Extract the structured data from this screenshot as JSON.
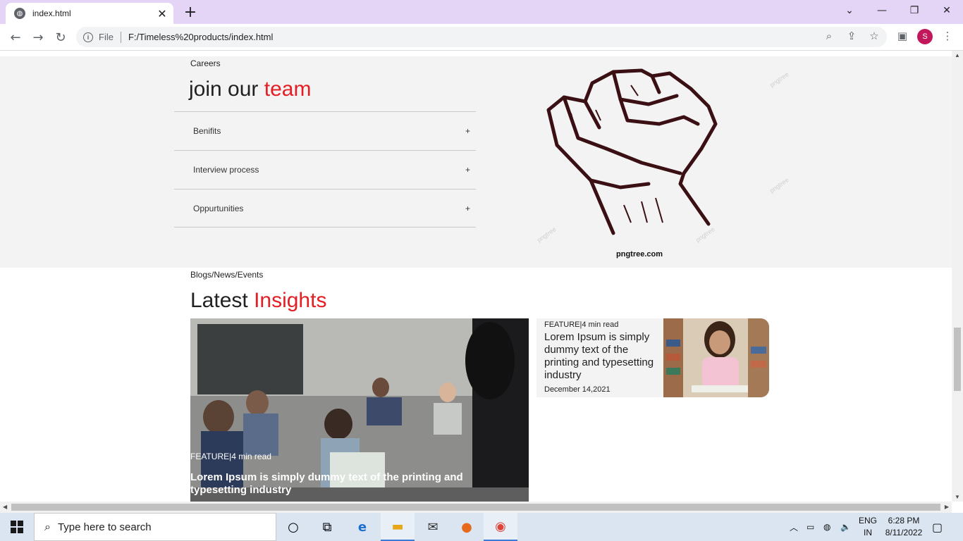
{
  "browser": {
    "tab_title": "index.html",
    "scheme_label": "File",
    "url": "F:/Timeless%20products/index.html",
    "profile_initial": "S"
  },
  "careers": {
    "eyebrow": "Careers",
    "title_plain": "join our ",
    "title_accent": "team",
    "accordion": [
      {
        "label": "Benifits",
        "icon": "+"
      },
      {
        "label": "Interview process",
        "icon": "+"
      },
      {
        "label": "Oppurtunities",
        "icon": "+"
      }
    ],
    "image_caption": "pngtree.com",
    "watermark": "pngtree"
  },
  "insights": {
    "eyebrow": "Blogs/News/Events",
    "title_plain": "Latest ",
    "title_accent": "Insights",
    "main_card": {
      "meta": "FEATURE|4 min read",
      "title": "Lorem Ipsum is simply dummy text of the printing and typesetting industry"
    },
    "side_card": {
      "meta": "FEATURE|4 min read",
      "title": "Lorem Ipsum is simply dummy text of the printing and typesetting industry",
      "date": "December 14,2021"
    }
  },
  "taskbar": {
    "search_placeholder": "Type here to search",
    "lang_top": "ENG",
    "lang_bottom": "IN",
    "time": "6:28 PM",
    "date": "8/11/2022"
  },
  "colors": {
    "accent": "#e31e24",
    "titlebar": "#e4d4f6",
    "section_bg": "#f4f3f3",
    "profile": "#c2185b"
  }
}
